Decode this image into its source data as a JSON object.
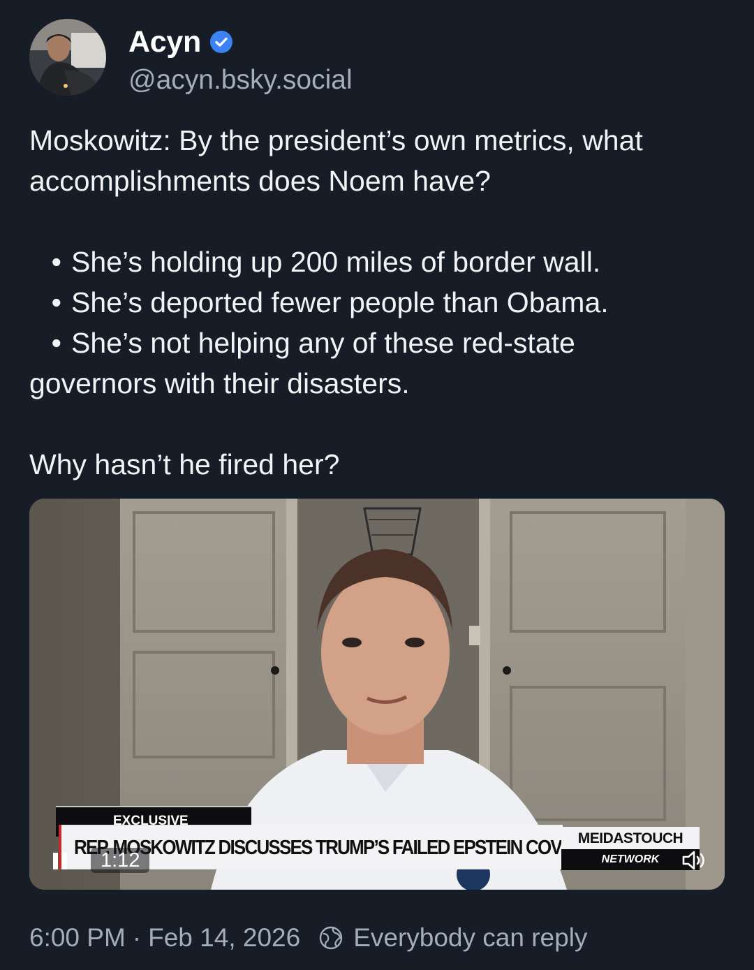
{
  "post": {
    "author": {
      "name": "Acyn",
      "handle": "@acyn.bsky.social",
      "verified_icon": "verified-check-icon",
      "verified_color": "#3b82f6"
    },
    "text": {
      "intro": "Moskowitz: By the president’s own metrics, what accomplishments does Noem have?",
      "bullets": [
        "She’s holding up 200 miles of border wall.",
        "She’s deported fewer people than Obama.",
        "She’s not helping any of these red-state"
      ],
      "bullet_continuation": "governors with their disasters.",
      "closing": "Why hasn’t he fired her?"
    },
    "video": {
      "tag": "EXCLUSIVE",
      "headline": "REP. MOSKOWITZ DISCUSSES TRUMP’S FAILED EPSTEIN COVER UP",
      "brand_top": "MEIDASTOUCH",
      "brand_bottom": "NETWORK",
      "elapsed": "1:12"
    },
    "footer": {
      "time": "6:00 PM",
      "separator": "·",
      "date": "Feb 14, 2026",
      "reply_setting": "Everybody can reply"
    }
  },
  "colors": {
    "background": "#171d27",
    "text_primary": "#f1f3f5",
    "text_secondary": "#a3adbb",
    "accent_blue": "#3b82f6"
  }
}
